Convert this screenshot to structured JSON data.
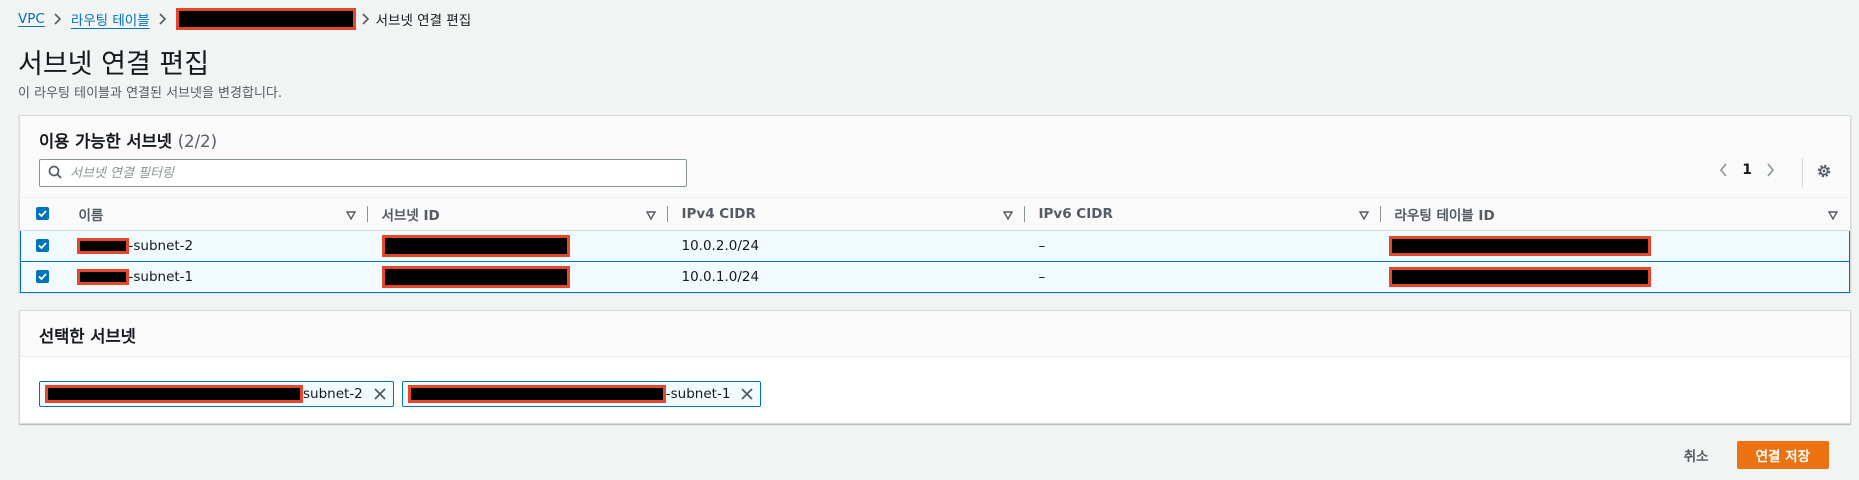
{
  "breadcrumb": {
    "vpc": "VPC",
    "route_tables": "라우팅 테이블",
    "current": "서브넷 연결 편집"
  },
  "page": {
    "title": "서브넷 연결 편집",
    "description": "이 라우팅 테이블과 연결된 서브넷을 변경합니다."
  },
  "available": {
    "title": "이용 가능한 서브넷",
    "count": "(2/2)",
    "search_placeholder": "서브넷 연결 필터링",
    "page_number": "1",
    "columns": [
      "이름",
      "서브넷 ID",
      "IPv4 CIDR",
      "IPv6 CIDR",
      "라우팅 테이블 ID"
    ],
    "rows": [
      {
        "name_suffix": "-subnet-2",
        "ipv4": "10.0.2.0/24",
        "ipv6": "–",
        "checked": true
      },
      {
        "name_suffix": "-subnet-1",
        "ipv4": "10.0.1.0/24",
        "ipv6": "–",
        "checked": true
      }
    ]
  },
  "selected": {
    "title": "선택한 서브넷",
    "tokens": [
      {
        "suffix": "subnet-2"
      },
      {
        "suffix": "-subnet-1"
      }
    ]
  },
  "actions": {
    "cancel": "취소",
    "save": "연결 저장"
  },
  "colors": {
    "link": "#0073bb",
    "primary": "#ec7211",
    "redaction_border": "#e5472b"
  }
}
